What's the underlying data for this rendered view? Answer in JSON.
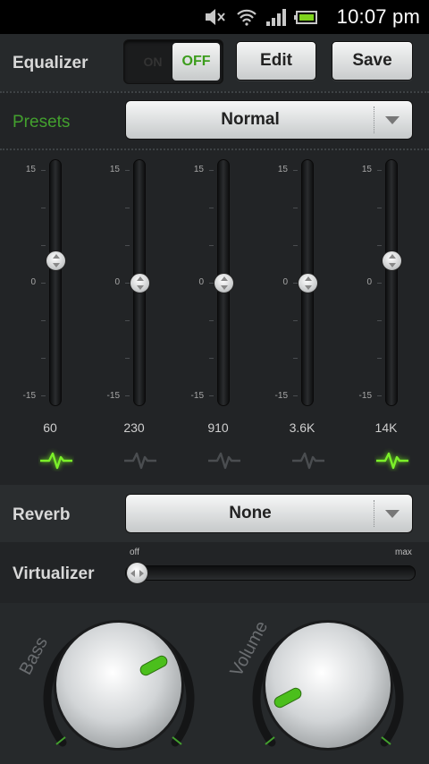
{
  "status_bar": {
    "time": "10:07 pm",
    "icons": [
      "mute-icon",
      "wifi-icon",
      "signal-icon",
      "battery-icon"
    ]
  },
  "equalizer": {
    "label": "Equalizer",
    "toggle_on": "ON",
    "toggle_off": "OFF",
    "toggle_state": "off",
    "edit_label": "Edit",
    "save_label": "Save"
  },
  "presets": {
    "label": "Presets",
    "selected": "Normal"
  },
  "bands": [
    {
      "freq": "60",
      "gain_db": 3,
      "scale_top": "15",
      "scale_mid": "0",
      "scale_bottom": "-15",
      "active": true
    },
    {
      "freq": "230",
      "gain_db": 0,
      "scale_top": "15",
      "scale_mid": "0",
      "scale_bottom": "-15",
      "active": false
    },
    {
      "freq": "910",
      "gain_db": 0,
      "scale_top": "15",
      "scale_mid": "0",
      "scale_bottom": "-15",
      "active": false
    },
    {
      "freq": "3.6K",
      "gain_db": 0,
      "scale_top": "15",
      "scale_mid": "0",
      "scale_bottom": "-15",
      "active": false
    },
    {
      "freq": "14K",
      "gain_db": 3,
      "scale_top": "15",
      "scale_mid": "0",
      "scale_bottom": "-15",
      "active": true
    }
  ],
  "reverb": {
    "label": "Reverb",
    "selected": "None"
  },
  "virtualizer": {
    "label": "Virtualizer",
    "min_label": "off",
    "max_label": "max",
    "level": 0
  },
  "dials": {
    "bass_label": "Bass",
    "volume_label": "Volume"
  },
  "colors": {
    "accent_green": "#43a02e",
    "background": "#222426"
  }
}
